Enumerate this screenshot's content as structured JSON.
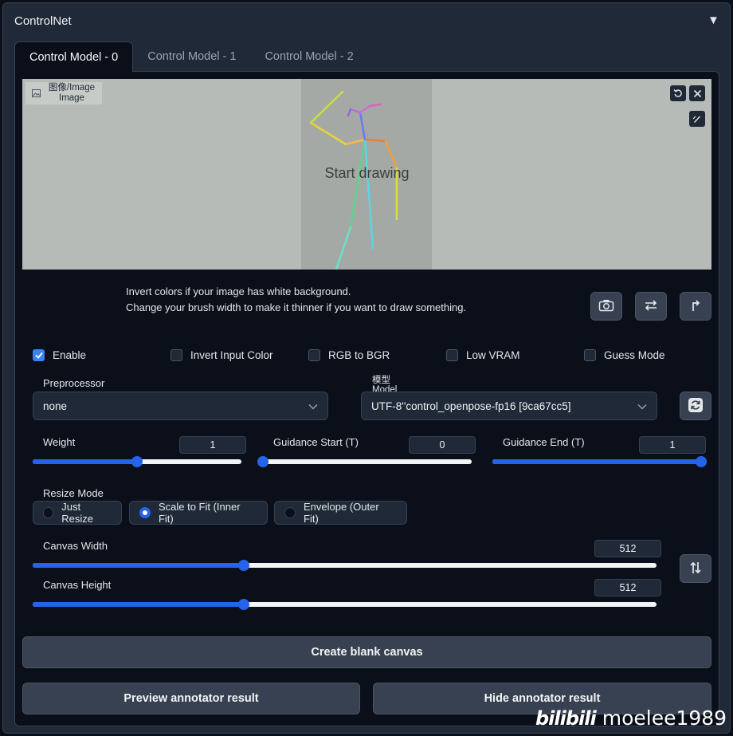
{
  "panel": {
    "title": "ControlNet",
    "toggle_icon": "▼"
  },
  "tabs": [
    {
      "label": "Control Model - 0",
      "active": true
    },
    {
      "label": "Control Model - 1",
      "active": false
    },
    {
      "label": "Control Model - 2",
      "active": false
    }
  ],
  "image_input": {
    "label_line1": "图像/Image",
    "label_line2": "Image",
    "placeholder": "Start drawing",
    "background_color": "#b7bbb7"
  },
  "info": {
    "line1": "Invert colors if your image has white background.",
    "line2": "Change your brush width to make it thinner if you want to draw something."
  },
  "checkboxes": [
    {
      "label": "Enable",
      "checked": true
    },
    {
      "label": "Invert Input Color",
      "checked": false
    },
    {
      "label": "RGB to BGR",
      "checked": false
    },
    {
      "label": "Low VRAM",
      "checked": false
    },
    {
      "label": "Guess Mode",
      "checked": false
    }
  ],
  "preprocessor": {
    "label": "Preprocessor",
    "value": "none"
  },
  "model": {
    "label_line1": "模型",
    "label_line2": "Model",
    "value": "UTF-8''control_openpose-fp16 [9ca67cc5]"
  },
  "weight": {
    "label": "Weight",
    "value": "1",
    "fraction": 0.5
  },
  "guidance_start": {
    "label": "Guidance Start (T)",
    "value": "0",
    "fraction": 0.0
  },
  "guidance_end": {
    "label": "Guidance End (T)",
    "value": "1",
    "fraction": 1.0
  },
  "resize_mode": {
    "label": "Resize Mode",
    "options": [
      "Just Resize",
      "Scale to Fit (Inner Fit)",
      "Envelope (Outer Fit)"
    ],
    "selected": "Scale to Fit (Inner Fit)"
  },
  "canvas_width": {
    "label": "Canvas Width",
    "value": "512",
    "fraction": 0.339
  },
  "canvas_height": {
    "label": "Canvas Height",
    "value": "512",
    "fraction": 0.339
  },
  "buttons": {
    "create_canvas": "Create blank canvas",
    "preview": "Preview annotator result",
    "hide": "Hide annotator result"
  },
  "watermark": {
    "logo": "bilibili",
    "user": "moelee1989"
  },
  "colors": {
    "accent": "#2563eb",
    "panel_bg": "#1f2937",
    "page_bg": "#0b0f19"
  }
}
